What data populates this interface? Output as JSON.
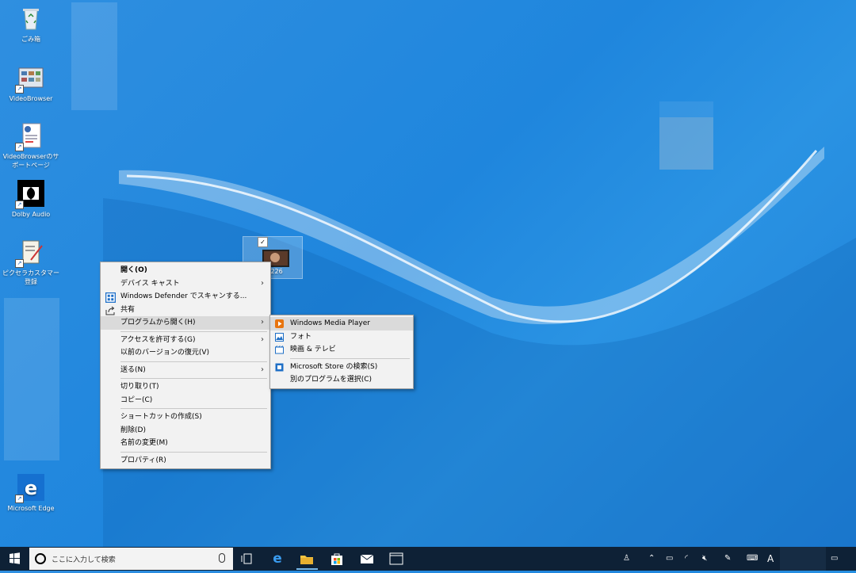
{
  "desktop_icons": [
    {
      "label": "ごみ箱"
    },
    {
      "label": "VideoBrowser"
    },
    {
      "label": "VideoBrowserのサポートページ"
    },
    {
      "label": "Dolby Audio"
    },
    {
      "label": "ピクセラカスタマー登録"
    },
    {
      "label": "Microsoft Edge"
    }
  ],
  "selected_file": {
    "name": "51226",
    "checked": "✓"
  },
  "context_menu": {
    "open": "開く(O)",
    "cast": "デバイス キャスト",
    "defender": "Windows Defender でスキャンする...",
    "share": "共有",
    "open_with": "プログラムから開く(H)",
    "give_access": "アクセスを許可する(G)",
    "restore": "以前のバージョンの復元(V)",
    "send_to": "送る(N)",
    "cut": "切り取り(T)",
    "copy": "コピー(C)",
    "create_shortcut": "ショートカットの作成(S)",
    "delete": "削除(D)",
    "rename": "名前の変更(M)",
    "properties": "プロパティ(R)"
  },
  "submenu": {
    "wmp": "Windows Media Player",
    "photos": "フォト",
    "movies": "映画 & テレビ",
    "store": "Microsoft Store の検索(S)",
    "choose": "別のプログラムを選択(C)"
  },
  "taskbar": {
    "search_placeholder": "ここに入力して検索",
    "ime": "A"
  },
  "colors": {
    "accent": "#0078d7",
    "taskbar": "#0e2136"
  }
}
